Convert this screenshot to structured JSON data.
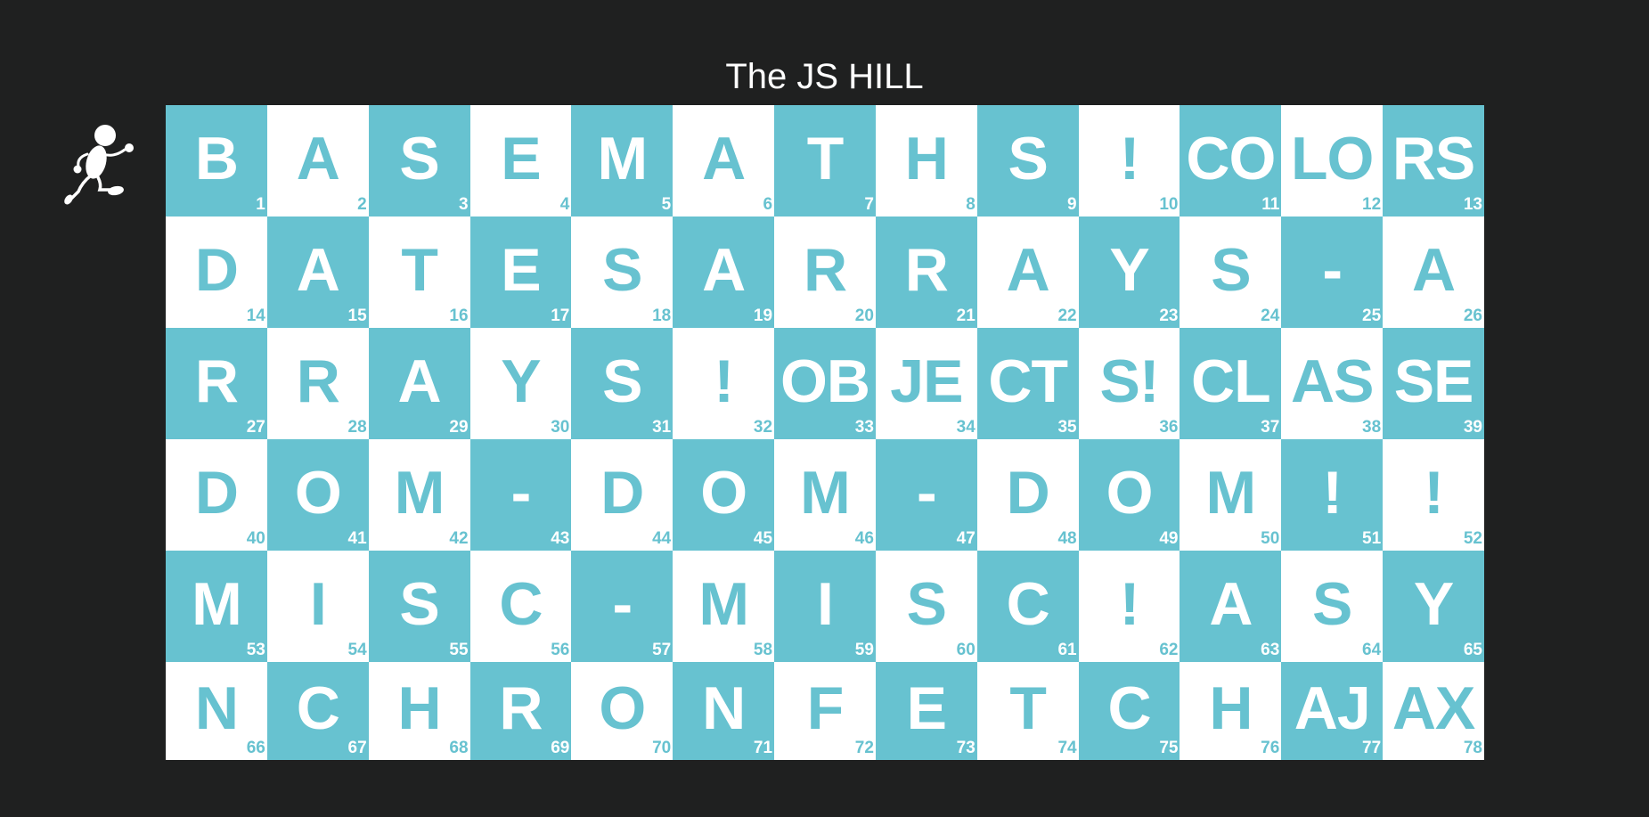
{
  "title": "The JS HILL",
  "icons": {
    "player": "running-man-icon"
  },
  "colors": {
    "teal": "#67c2d0",
    "white": "#ffffff",
    "background": "#1f2020"
  },
  "board": {
    "columns": 13,
    "cells": [
      {
        "n": "1",
        "t": "B"
      },
      {
        "n": "2",
        "t": "A"
      },
      {
        "n": "3",
        "t": "S"
      },
      {
        "n": "4",
        "t": "E"
      },
      {
        "n": "5",
        "t": "M"
      },
      {
        "n": "6",
        "t": "A"
      },
      {
        "n": "7",
        "t": "T"
      },
      {
        "n": "8",
        "t": "H"
      },
      {
        "n": "9",
        "t": "S"
      },
      {
        "n": "10",
        "t": "!"
      },
      {
        "n": "11",
        "t": "CO"
      },
      {
        "n": "12",
        "t": "LO"
      },
      {
        "n": "13",
        "t": "RS"
      },
      {
        "n": "14",
        "t": "D"
      },
      {
        "n": "15",
        "t": "A"
      },
      {
        "n": "16",
        "t": "T"
      },
      {
        "n": "17",
        "t": "E"
      },
      {
        "n": "18",
        "t": "S"
      },
      {
        "n": "19",
        "t": "A"
      },
      {
        "n": "20",
        "t": "R"
      },
      {
        "n": "21",
        "t": "R"
      },
      {
        "n": "22",
        "t": "A"
      },
      {
        "n": "23",
        "t": "Y"
      },
      {
        "n": "24",
        "t": "S"
      },
      {
        "n": "25",
        "t": "-"
      },
      {
        "n": "26",
        "t": "A"
      },
      {
        "n": "27",
        "t": "R"
      },
      {
        "n": "28",
        "t": "R"
      },
      {
        "n": "29",
        "t": "A"
      },
      {
        "n": "30",
        "t": "Y"
      },
      {
        "n": "31",
        "t": "S"
      },
      {
        "n": "32",
        "t": "!"
      },
      {
        "n": "33",
        "t": "OB"
      },
      {
        "n": "34",
        "t": "JE"
      },
      {
        "n": "35",
        "t": "CT"
      },
      {
        "n": "36",
        "t": "S!"
      },
      {
        "n": "37",
        "t": "CL"
      },
      {
        "n": "38",
        "t": "AS"
      },
      {
        "n": "39",
        "t": "SE"
      },
      {
        "n": "40",
        "t": "D"
      },
      {
        "n": "41",
        "t": "O"
      },
      {
        "n": "42",
        "t": "M"
      },
      {
        "n": "43",
        "t": "-"
      },
      {
        "n": "44",
        "t": "D"
      },
      {
        "n": "45",
        "t": "O"
      },
      {
        "n": "46",
        "t": "M"
      },
      {
        "n": "47",
        "t": "-"
      },
      {
        "n": "48",
        "t": "D"
      },
      {
        "n": "49",
        "t": "O"
      },
      {
        "n": "50",
        "t": "M"
      },
      {
        "n": "51",
        "t": "!"
      },
      {
        "n": "52",
        "t": "!"
      },
      {
        "n": "53",
        "t": "M"
      },
      {
        "n": "54",
        "t": "I"
      },
      {
        "n": "55",
        "t": "S"
      },
      {
        "n": "56",
        "t": "C"
      },
      {
        "n": "57",
        "t": "-"
      },
      {
        "n": "58",
        "t": "M"
      },
      {
        "n": "59",
        "t": "I"
      },
      {
        "n": "60",
        "t": "S"
      },
      {
        "n": "61",
        "t": "C"
      },
      {
        "n": "62",
        "t": "!"
      },
      {
        "n": "63",
        "t": "A"
      },
      {
        "n": "64",
        "t": "S"
      },
      {
        "n": "65",
        "t": "Y"
      },
      {
        "n": "66",
        "t": "N"
      },
      {
        "n": "67",
        "t": "C"
      },
      {
        "n": "68",
        "t": "H"
      },
      {
        "n": "69",
        "t": "R"
      },
      {
        "n": "70",
        "t": "O"
      },
      {
        "n": "71",
        "t": "N"
      },
      {
        "n": "72",
        "t": "F"
      },
      {
        "n": "73",
        "t": "E"
      },
      {
        "n": "74",
        "t": "T"
      },
      {
        "n": "75",
        "t": "C"
      },
      {
        "n": "76",
        "t": "H"
      },
      {
        "n": "77",
        "t": "AJ"
      },
      {
        "n": "78",
        "t": "AX"
      }
    ]
  }
}
